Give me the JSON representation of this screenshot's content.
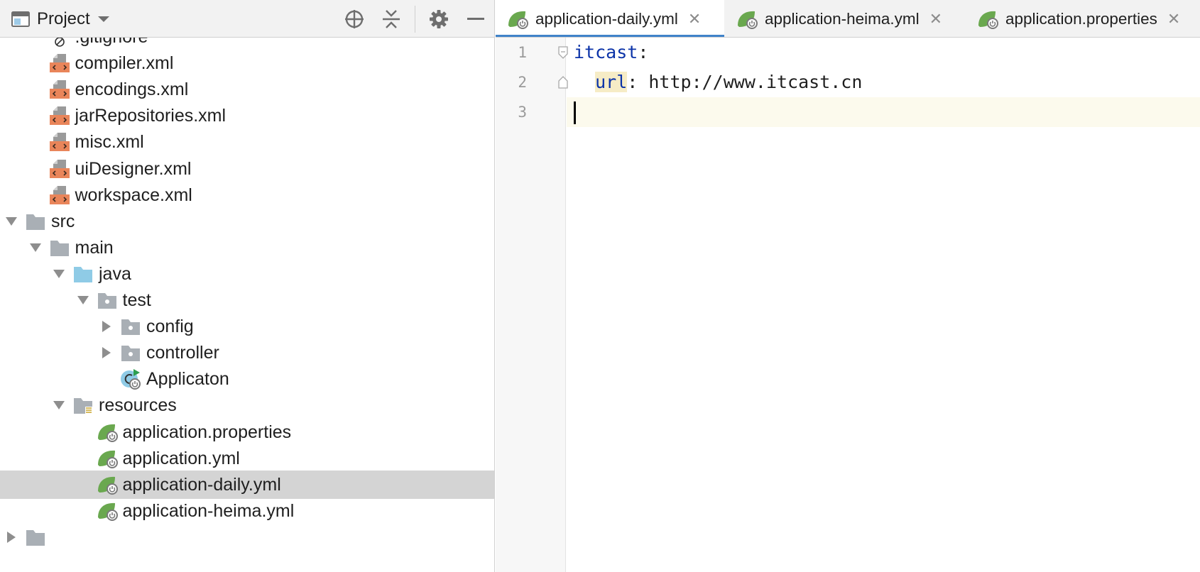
{
  "project_panel": {
    "title": "Project",
    "toolbar_icons": [
      "locate-icon",
      "collapse-all-icon",
      "gear-icon",
      "minimize-icon"
    ]
  },
  "tree": [
    {
      "label": ".gitignore",
      "icon": "gitignore-file-icon",
      "level": 3,
      "arrow": "none",
      "selected": false
    },
    {
      "label": "compiler.xml",
      "icon": "xml-file-icon",
      "level": 3,
      "arrow": "none",
      "selected": false
    },
    {
      "label": "encodings.xml",
      "icon": "xml-file-icon",
      "level": 3,
      "arrow": "none",
      "selected": false
    },
    {
      "label": "jarRepositories.xml",
      "icon": "xml-file-icon",
      "level": 3,
      "arrow": "none",
      "selected": false
    },
    {
      "label": "misc.xml",
      "icon": "xml-file-icon",
      "level": 3,
      "arrow": "none",
      "selected": false
    },
    {
      "label": "uiDesigner.xml",
      "icon": "xml-file-icon",
      "level": 3,
      "arrow": "none",
      "selected": false
    },
    {
      "label": "workspace.xml",
      "icon": "xml-file-icon",
      "level": 3,
      "arrow": "none",
      "selected": false
    },
    {
      "label": "src",
      "icon": "folder-icon",
      "level": 2,
      "arrow": "expanded",
      "selected": false
    },
    {
      "label": "main",
      "icon": "folder-icon",
      "level": 3,
      "arrow": "expanded",
      "selected": false
    },
    {
      "label": "java",
      "icon": "source-folder-icon",
      "level": 4,
      "arrow": "expanded",
      "selected": false
    },
    {
      "label": "test",
      "icon": "package-icon",
      "level": 5,
      "arrow": "expanded",
      "selected": false
    },
    {
      "label": "config",
      "icon": "package-icon",
      "level": 6,
      "arrow": "collapsed",
      "selected": false
    },
    {
      "label": "controller",
      "icon": "package-icon",
      "level": 6,
      "arrow": "collapsed",
      "selected": false
    },
    {
      "label": "Applicaton",
      "icon": "spring-boot-class-icon",
      "level": 6,
      "arrow": "none",
      "selected": false
    },
    {
      "label": "resources",
      "icon": "resources-folder-icon",
      "level": 4,
      "arrow": "expanded",
      "selected": false
    },
    {
      "label": "application.properties",
      "icon": "spring-config-icon",
      "level": 5,
      "arrow": "none",
      "selected": false
    },
    {
      "label": "application.yml",
      "icon": "spring-config-icon",
      "level": 5,
      "arrow": "none",
      "selected": false
    },
    {
      "label": "application-daily.yml",
      "icon": "spring-config-icon",
      "level": 5,
      "arrow": "none",
      "selected": true
    },
    {
      "label": "application-heima.yml",
      "icon": "spring-config-icon",
      "level": 5,
      "arrow": "none",
      "selected": false
    },
    {
      "label": "",
      "icon": "folder-icon",
      "level": 2,
      "arrow": "collapsed",
      "selected": false
    }
  ],
  "tabs": [
    {
      "label": "application-daily.yml",
      "active": true
    },
    {
      "label": "application-heima.yml",
      "active": false
    },
    {
      "label": "application.properties",
      "active": false
    }
  ],
  "editor": {
    "line_numbers": [
      "1",
      "2",
      "3"
    ],
    "current_line": 3,
    "lines": [
      {
        "indent": "",
        "key": "itcast",
        "sep": ":",
        "value": "",
        "key_highlight": false
      },
      {
        "indent": "  ",
        "key": "url",
        "sep": ": ",
        "value": "http://www.itcast.cn",
        "key_highlight": true
      },
      {
        "indent": "",
        "key": "",
        "sep": "",
        "value": "",
        "key_highlight": false
      }
    ]
  },
  "colors": {
    "accent_tab_underline": "#4083c9",
    "selection": "#d4d4d4",
    "yaml_key": "#0b33a8",
    "current_line": "#fcfaed"
  }
}
